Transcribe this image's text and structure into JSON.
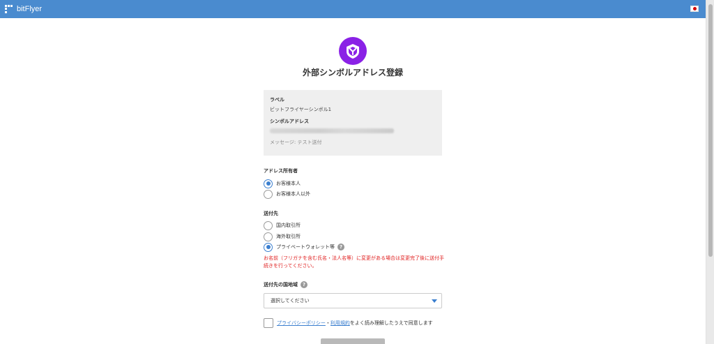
{
  "header": {
    "brand": "bitFlyer",
    "flag_icon": "japan-flag-icon"
  },
  "page": {
    "title": "外部シンボルアドレス登録",
    "logo_icon": "symbol-logo-icon",
    "logo_color": "#8a21e6"
  },
  "info": {
    "label_title": "ラベル",
    "label_value": "ビットフライヤーシンボル1",
    "address_title": "シンボルアドレス",
    "address_value_note": "blurred",
    "message": "メッセージ: テスト送付"
  },
  "owner": {
    "title": "アドレス所有者",
    "options": [
      "お客様本人",
      "お客様本人以外"
    ],
    "selected": 0
  },
  "destination": {
    "title": "送付先",
    "options": [
      "国内取引所",
      "海外取引所",
      "プライベートウォレット等"
    ],
    "selected": 2,
    "help": "?"
  },
  "warning": "お名前（フリガナを含む氏名・法人名等）に変更がある場合は変更完了後に送付手続きを行ってください。",
  "country": {
    "title": "送付先の国地域",
    "help": "?",
    "select_value": "選択してください"
  },
  "consent": {
    "privacy": "プライバシーポリシー",
    "sep": "・",
    "terms": "利用規約",
    "rest": "をよく読み理解したうえで同意します"
  },
  "colors": {
    "header": "#4a8bcf",
    "accent": "#3b7fcf",
    "warning": "#e02020"
  }
}
